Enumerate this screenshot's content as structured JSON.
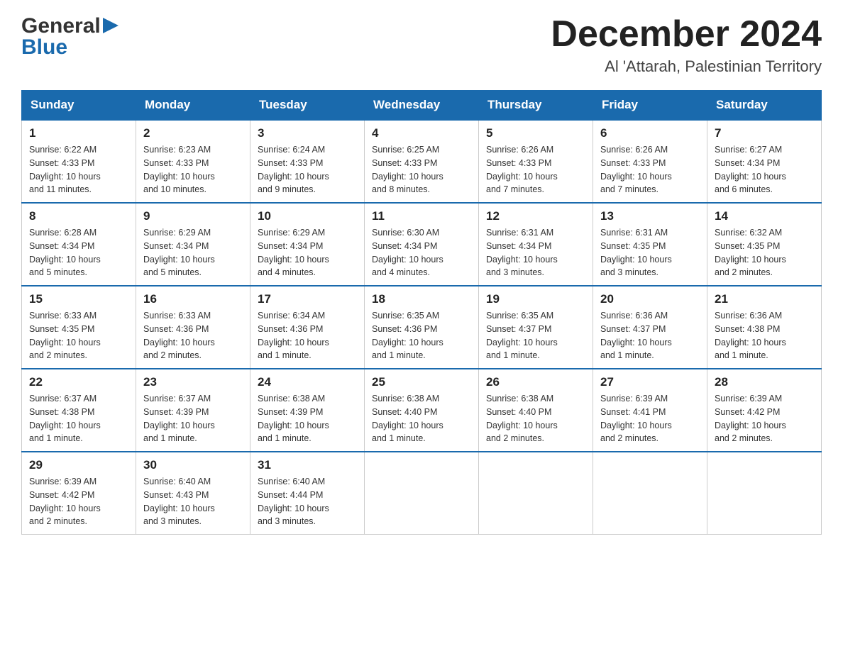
{
  "header": {
    "logo_line1": "General",
    "logo_line2": "Blue",
    "month_title": "December 2024",
    "location": "Al 'Attarah, Palestinian Territory"
  },
  "days_of_week": [
    "Sunday",
    "Monday",
    "Tuesday",
    "Wednesday",
    "Thursday",
    "Friday",
    "Saturday"
  ],
  "weeks": [
    [
      {
        "day": "1",
        "sunrise": "6:22 AM",
        "sunset": "4:33 PM",
        "daylight": "10 hours and 11 minutes."
      },
      {
        "day": "2",
        "sunrise": "6:23 AM",
        "sunset": "4:33 PM",
        "daylight": "10 hours and 10 minutes."
      },
      {
        "day": "3",
        "sunrise": "6:24 AM",
        "sunset": "4:33 PM",
        "daylight": "10 hours and 9 minutes."
      },
      {
        "day": "4",
        "sunrise": "6:25 AM",
        "sunset": "4:33 PM",
        "daylight": "10 hours and 8 minutes."
      },
      {
        "day": "5",
        "sunrise": "6:26 AM",
        "sunset": "4:33 PM",
        "daylight": "10 hours and 7 minutes."
      },
      {
        "day": "6",
        "sunrise": "6:26 AM",
        "sunset": "4:33 PM",
        "daylight": "10 hours and 7 minutes."
      },
      {
        "day": "7",
        "sunrise": "6:27 AM",
        "sunset": "4:34 PM",
        "daylight": "10 hours and 6 minutes."
      }
    ],
    [
      {
        "day": "8",
        "sunrise": "6:28 AM",
        "sunset": "4:34 PM",
        "daylight": "10 hours and 5 minutes."
      },
      {
        "day": "9",
        "sunrise": "6:29 AM",
        "sunset": "4:34 PM",
        "daylight": "10 hours and 5 minutes."
      },
      {
        "day": "10",
        "sunrise": "6:29 AM",
        "sunset": "4:34 PM",
        "daylight": "10 hours and 4 minutes."
      },
      {
        "day": "11",
        "sunrise": "6:30 AM",
        "sunset": "4:34 PM",
        "daylight": "10 hours and 4 minutes."
      },
      {
        "day": "12",
        "sunrise": "6:31 AM",
        "sunset": "4:34 PM",
        "daylight": "10 hours and 3 minutes."
      },
      {
        "day": "13",
        "sunrise": "6:31 AM",
        "sunset": "4:35 PM",
        "daylight": "10 hours and 3 minutes."
      },
      {
        "day": "14",
        "sunrise": "6:32 AM",
        "sunset": "4:35 PM",
        "daylight": "10 hours and 2 minutes."
      }
    ],
    [
      {
        "day": "15",
        "sunrise": "6:33 AM",
        "sunset": "4:35 PM",
        "daylight": "10 hours and 2 minutes."
      },
      {
        "day": "16",
        "sunrise": "6:33 AM",
        "sunset": "4:36 PM",
        "daylight": "10 hours and 2 minutes."
      },
      {
        "day": "17",
        "sunrise": "6:34 AM",
        "sunset": "4:36 PM",
        "daylight": "10 hours and 1 minute."
      },
      {
        "day": "18",
        "sunrise": "6:35 AM",
        "sunset": "4:36 PM",
        "daylight": "10 hours and 1 minute."
      },
      {
        "day": "19",
        "sunrise": "6:35 AM",
        "sunset": "4:37 PM",
        "daylight": "10 hours and 1 minute."
      },
      {
        "day": "20",
        "sunrise": "6:36 AM",
        "sunset": "4:37 PM",
        "daylight": "10 hours and 1 minute."
      },
      {
        "day": "21",
        "sunrise": "6:36 AM",
        "sunset": "4:38 PM",
        "daylight": "10 hours and 1 minute."
      }
    ],
    [
      {
        "day": "22",
        "sunrise": "6:37 AM",
        "sunset": "4:38 PM",
        "daylight": "10 hours and 1 minute."
      },
      {
        "day": "23",
        "sunrise": "6:37 AM",
        "sunset": "4:39 PM",
        "daylight": "10 hours and 1 minute."
      },
      {
        "day": "24",
        "sunrise": "6:38 AM",
        "sunset": "4:39 PM",
        "daylight": "10 hours and 1 minute."
      },
      {
        "day": "25",
        "sunrise": "6:38 AM",
        "sunset": "4:40 PM",
        "daylight": "10 hours and 1 minute."
      },
      {
        "day": "26",
        "sunrise": "6:38 AM",
        "sunset": "4:40 PM",
        "daylight": "10 hours and 2 minutes."
      },
      {
        "day": "27",
        "sunrise": "6:39 AM",
        "sunset": "4:41 PM",
        "daylight": "10 hours and 2 minutes."
      },
      {
        "day": "28",
        "sunrise": "6:39 AM",
        "sunset": "4:42 PM",
        "daylight": "10 hours and 2 minutes."
      }
    ],
    [
      {
        "day": "29",
        "sunrise": "6:39 AM",
        "sunset": "4:42 PM",
        "daylight": "10 hours and 2 minutes."
      },
      {
        "day": "30",
        "sunrise": "6:40 AM",
        "sunset": "4:43 PM",
        "daylight": "10 hours and 3 minutes."
      },
      {
        "day": "31",
        "sunrise": "6:40 AM",
        "sunset": "4:44 PM",
        "daylight": "10 hours and 3 minutes."
      },
      null,
      null,
      null,
      null
    ]
  ],
  "labels": {
    "sunrise": "Sunrise:",
    "sunset": "Sunset:",
    "daylight": "Daylight:"
  }
}
